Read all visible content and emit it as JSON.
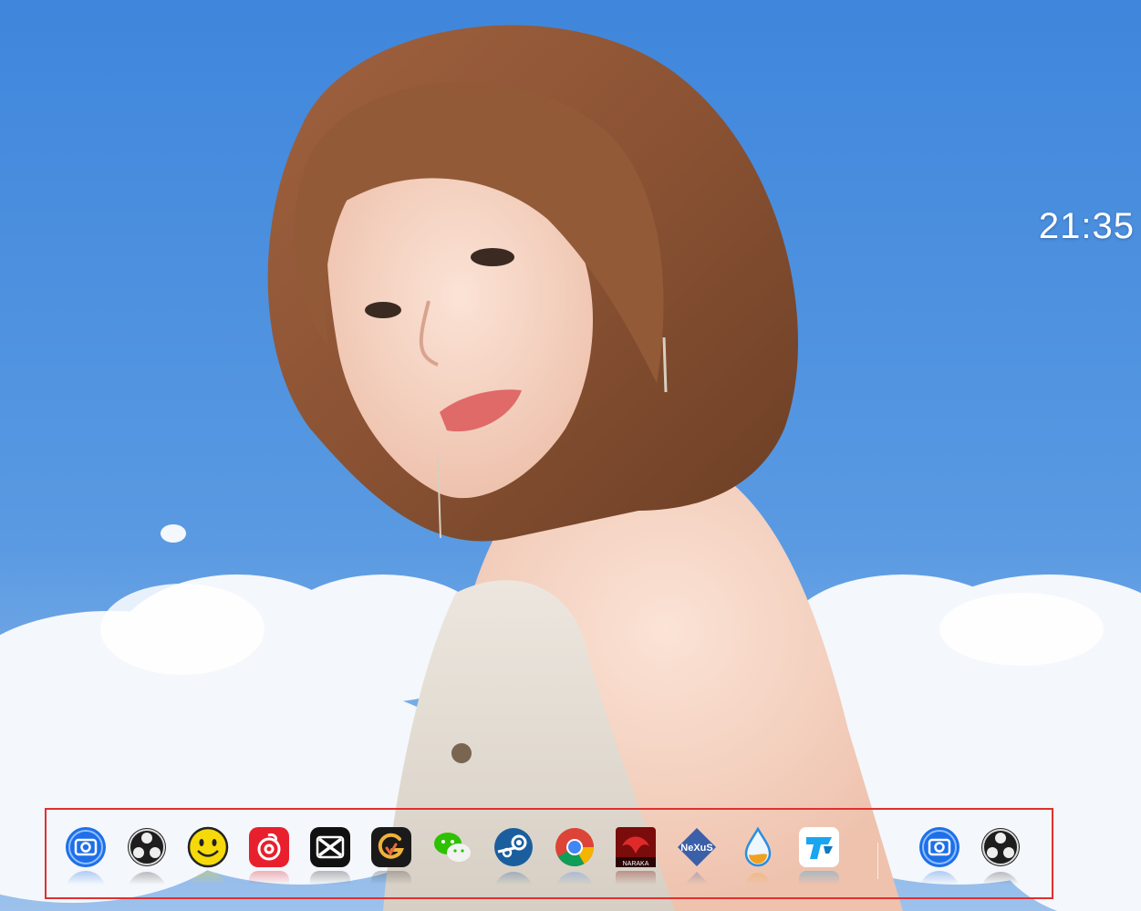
{
  "clock": {
    "time": "21:35"
  },
  "dock": {
    "apps": [
      {
        "name": "Screenshot tool",
        "icon": "camera-icon",
        "color": "#1e6fe8"
      },
      {
        "name": "OBS Studio",
        "icon": "obs-icon",
        "color": "#222222"
      },
      {
        "name": "Smiley",
        "icon": "smiley-icon",
        "color": "#f5d90a"
      },
      {
        "name": "NetEase Music",
        "icon": "netease-music-icon",
        "color": "#e8202e"
      },
      {
        "name": "CapCut",
        "icon": "capcut-icon",
        "color": "#111111"
      },
      {
        "name": "App G",
        "icon": "g-app-icon",
        "color": "#1a1a1a"
      },
      {
        "name": "WeChat",
        "icon": "wechat-icon",
        "color": "#2dc100"
      },
      {
        "name": "Steam",
        "icon": "steam-icon",
        "color": "#1b5e9e"
      },
      {
        "name": "Chrome",
        "icon": "chrome-icon",
        "color": "#4285f4"
      },
      {
        "name": "Naraka",
        "icon": "naraka-icon",
        "color": "#b81414",
        "label": "NARAKA"
      },
      {
        "name": "Nexus",
        "icon": "nexus-icon",
        "color": "#3b5fa8",
        "label": "NeXuS"
      },
      {
        "name": "Water drop",
        "icon": "droplet-icon",
        "color": "#2a8ee0"
      },
      {
        "name": "Transfer",
        "icon": "transfer-icon",
        "color": "#1aa5f0"
      }
    ],
    "pinned": [
      {
        "name": "Screenshot tool",
        "icon": "camera-icon",
        "color": "#1e6fe8"
      },
      {
        "name": "OBS Studio",
        "icon": "obs-icon",
        "color": "#222222"
      }
    ]
  }
}
